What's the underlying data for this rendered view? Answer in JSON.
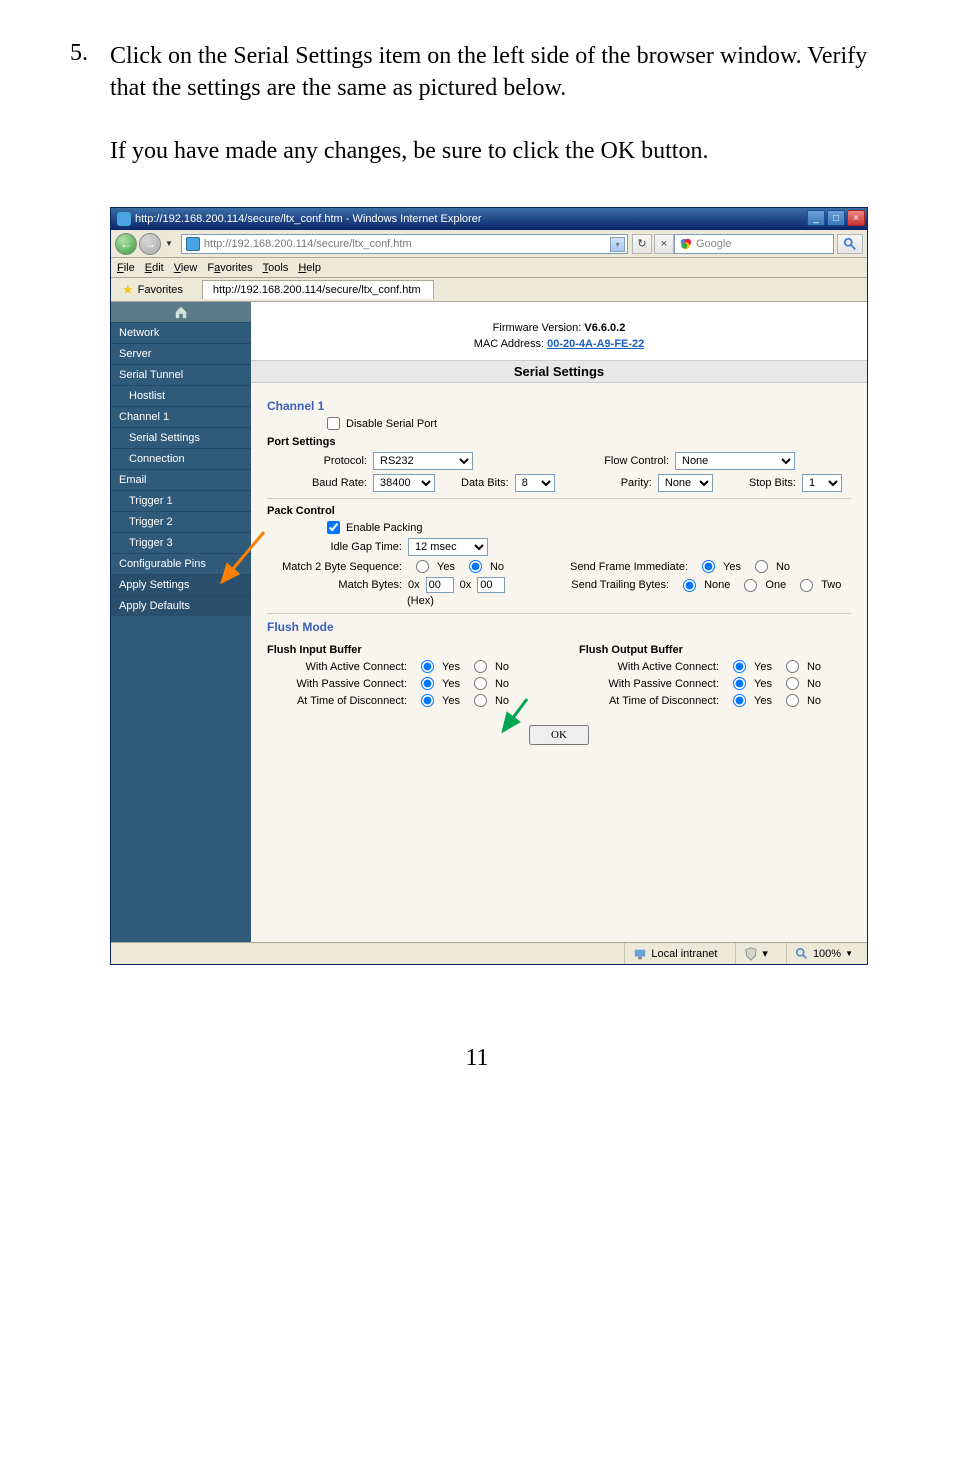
{
  "step": {
    "num": "5.",
    "text": "Click on the Serial Settings item on the left side of the browser window.  Verify that the settings are the same as pictured below."
  },
  "para2": "If you have made any changes, be sure to click the OK button.",
  "window": {
    "title": "http://192.168.200.114/secure/ltx_conf.htm - Windows Internet Explorer",
    "address": "http://192.168.200.114/secure/ltx_conf.htm",
    "search_provider": "Google",
    "menus": {
      "file": "File",
      "edit": "Edit",
      "view": "View",
      "favorites": "Favorites",
      "tools": "Tools",
      "help": "Help"
    },
    "fav_label": "Favorites",
    "tab": "http://192.168.200.114/secure/ltx_conf.htm"
  },
  "topinfo": {
    "fw_label": "Firmware Version:",
    "fw_val": "V6.6.0.2",
    "mac_label": "MAC Address:",
    "mac_val": "00-20-4A-A9-FE-22"
  },
  "panel_title": "Serial Settings",
  "sidebar": {
    "items": [
      {
        "label": "Network"
      },
      {
        "label": "Server"
      },
      {
        "label": "Serial Tunnel"
      },
      {
        "label": "Hostlist"
      },
      {
        "label": "Channel 1"
      },
      {
        "label": "Serial Settings"
      },
      {
        "label": "Connection"
      },
      {
        "label": "Email"
      },
      {
        "label": "Trigger 1"
      },
      {
        "label": "Trigger 2"
      },
      {
        "label": "Trigger 3"
      },
      {
        "label": "Configurable Pins"
      },
      {
        "label": "Apply Settings"
      },
      {
        "label": "Apply Defaults"
      }
    ]
  },
  "form": {
    "channel_h": "Channel 1",
    "disable_serial": "Disable Serial Port",
    "port_settings_h": "Port Settings",
    "protocol_lab": "Protocol:",
    "protocol_val": "RS232",
    "flow_lab": "Flow Control:",
    "flow_val": "None",
    "baud_lab": "Baud Rate:",
    "baud_val": "38400",
    "data_lab": "Data Bits:",
    "data_val": "8",
    "parity_lab": "Parity:",
    "parity_val": "None",
    "stop_lab": "Stop Bits:",
    "stop_val": "1",
    "pack_h": "Pack Control",
    "enable_pack": "Enable Packing",
    "idle_lab": "Idle Gap Time:",
    "idle_val": "12 msec",
    "m2b_lab": "Match 2 Byte Sequence:",
    "yes": "Yes",
    "no": "No",
    "sfi_lab": "Send Frame Immediate:",
    "mbytes_lab": "Match Bytes:",
    "hex_note": "(Hex)",
    "hex1": "00",
    "hex2": "00",
    "hexpfx": "0x",
    "stb_lab": "Send Trailing Bytes:",
    "none": "None",
    "one": "One",
    "two": "Two",
    "flush_h": "Flush Mode",
    "fib_h": "Flush Input Buffer",
    "fob_h": "Flush Output Buffer",
    "wac": "With Active Connect:",
    "wpc": "With Passive Connect:",
    "atd": "At Time of Disconnect:",
    "ok": "OK"
  },
  "status": {
    "zone": "Local intranet",
    "zoom": "100%"
  },
  "pagenum": "11"
}
